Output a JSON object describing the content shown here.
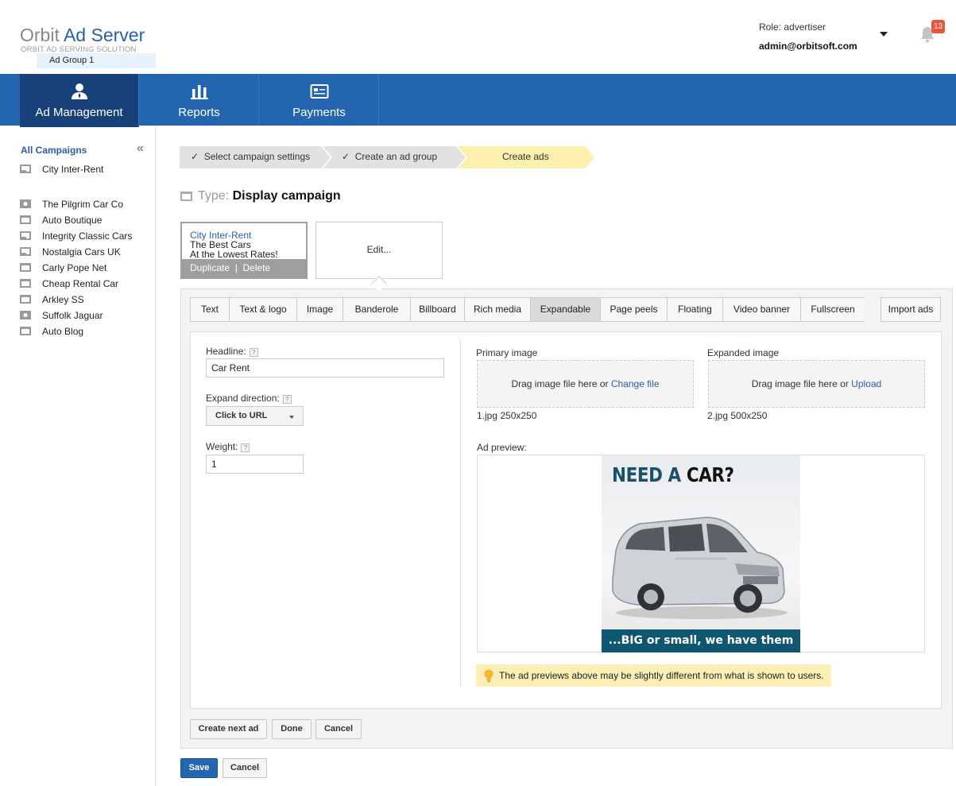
{
  "brand": {
    "name_part1": "Orbit ",
    "name_part2": "Ad Server",
    "tagline": "ORBIT AD SERVING SOLUTION",
    "accent_color": "#2465b0"
  },
  "user": {
    "role_label": "Role:",
    "role_value": "advertiser",
    "email": "admin@orbitsoft.com",
    "notifications": "13"
  },
  "nav": {
    "items": [
      {
        "label": "Ad Management",
        "icon": "user-icon",
        "active": true
      },
      {
        "label": "Reports",
        "icon": "bar-chart-icon",
        "active": false
      },
      {
        "label": "Payments",
        "icon": "payment-card-icon",
        "active": false
      }
    ]
  },
  "sidebar": {
    "title": "All Campaigns",
    "collapse_icon": "«",
    "campaigns": [
      {
        "label": "City Inter-Rent",
        "icon": "display-campaign-icon"
      },
      {
        "label": "The Pilgrim Car Co",
        "icon": "video-campaign-icon"
      },
      {
        "label": "Auto Boutique",
        "icon": "folder-campaign-icon"
      },
      {
        "label": "Integrity Classic Cars",
        "icon": "display-campaign-icon"
      },
      {
        "label": "Nostalgia Cars UK",
        "icon": "display-campaign-icon"
      },
      {
        "label": "Carly Pope Net",
        "icon": "folder-campaign-icon"
      },
      {
        "label": "Cheap Rental Car",
        "icon": "folder-campaign-icon"
      },
      {
        "label": "Arkley SS",
        "icon": "folder-campaign-icon"
      },
      {
        "label": "Suffolk Jaguar",
        "icon": "video-campaign-icon"
      },
      {
        "label": "Auto Blog",
        "icon": "folder-campaign-icon"
      }
    ],
    "selected_adgroup": "Ad Group 1"
  },
  "wizard": {
    "steps": [
      {
        "label": "Select campaign settings",
        "done": true
      },
      {
        "label": "Create an ad group",
        "done": true
      },
      {
        "label": "Create ads",
        "done": false,
        "current": true
      }
    ]
  },
  "campaign_type": {
    "label": "Type:",
    "value": "Display campaign"
  },
  "ad_card": {
    "title": "City Inter-Rent",
    "line1": "The Best Cars",
    "line2": "At the Lowest Rates!",
    "duplicate": "Duplicate",
    "separator": "|",
    "delete": "Delete"
  },
  "edit_card": {
    "label": "Edit..."
  },
  "tabs": {
    "items": [
      "Text",
      "Text & logo",
      "Image",
      "Banderole",
      "Billboard",
      "Rich media",
      "Expandable",
      "Page peels",
      "Floating",
      "Video banner",
      "Fullscreen"
    ],
    "active": "Expandable",
    "import": "Import ads"
  },
  "form": {
    "headline_label": "Headline:",
    "headline_value": "Car Rent",
    "expand_label": "Expand direction:",
    "expand_value": "Click to URL",
    "weight_label": "Weight:",
    "weight_value": "1",
    "help": "?",
    "primary_label": "Primary image",
    "primary_drop": "Drag image file here or ",
    "primary_link": "Change file",
    "primary_file": "1.jpg 250x250",
    "expanded_label": "Expanded image",
    "expanded_drop": "Drag image file here or ",
    "expanded_link": "Upload",
    "expanded_file": "2.jpg 500x250",
    "preview_label": "Ad preview:",
    "notice": "The ad previews above may be slightly different from what is shown to users."
  },
  "banner": {
    "headline_1": "NEED A ",
    "headline_2": "CAR?",
    "footer": "...BIG or small, we have them All!"
  },
  "buttons": {
    "create_next": "Create next ad",
    "done": "Done",
    "cancel": "Cancel",
    "save": "Save",
    "cancel_bottom": "Cancel"
  }
}
